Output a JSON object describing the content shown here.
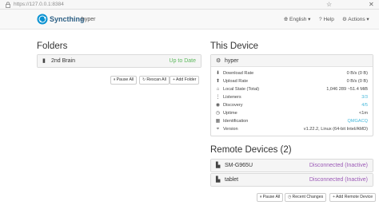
{
  "browser": {
    "url": "https://127.0.0.1:8384"
  },
  "navbar": {
    "brand": "Syncthing",
    "device_name": "hyper",
    "menu": {
      "language": "English",
      "help": "Help",
      "actions": "Actions"
    }
  },
  "folders": {
    "heading": "Folders",
    "items": [
      {
        "name": "2nd Brain",
        "status": "Up to Date"
      }
    ],
    "buttons": {
      "pause_all": "Pause All",
      "rescan_all": "Rescan All",
      "add_folder": "Add Folder"
    }
  },
  "this_device": {
    "heading": "This Device",
    "name": "hyper",
    "rows": [
      {
        "icon": "download-icon",
        "label": "Download Rate",
        "value": "0 B/s (0 B)"
      },
      {
        "icon": "upload-icon",
        "label": "Upload Rate",
        "value": "0 B/s (0 B)"
      },
      {
        "icon": "home-icon",
        "label": "Local State (Total)",
        "value": "1,046   289   ~51.4 MiB"
      },
      {
        "icon": "network-icon",
        "label": "Listeners",
        "value": "3/3"
      },
      {
        "icon": "discovery-icon",
        "label": "Discovery",
        "value": "4/5"
      },
      {
        "icon": "clock-icon",
        "label": "Uptime",
        "value": "<1m"
      },
      {
        "icon": "qrcode-icon",
        "label": "Identification",
        "value": "QMGACQ"
      },
      {
        "icon": "tag-icon",
        "label": "Version",
        "value": "v1.22.2, Linux (64-bit Intel/AMD)"
      }
    ]
  },
  "remote_devices": {
    "heading": "Remote Devices (2)",
    "items": [
      {
        "name": "SM-G965U",
        "status": "Disconnected (Inactive)"
      },
      {
        "name": "tablet",
        "status": "Disconnected (Inactive)"
      }
    ],
    "buttons": {
      "pause_all": "Pause All",
      "recent_changes": "Recent Changes",
      "add_remote_device": "Add Remote Device"
    }
  },
  "colors": {
    "up_to_date": "#5cb85c",
    "disconnected": "#9b59b6",
    "link": "#46b8da",
    "brand": "#2c5f84"
  }
}
